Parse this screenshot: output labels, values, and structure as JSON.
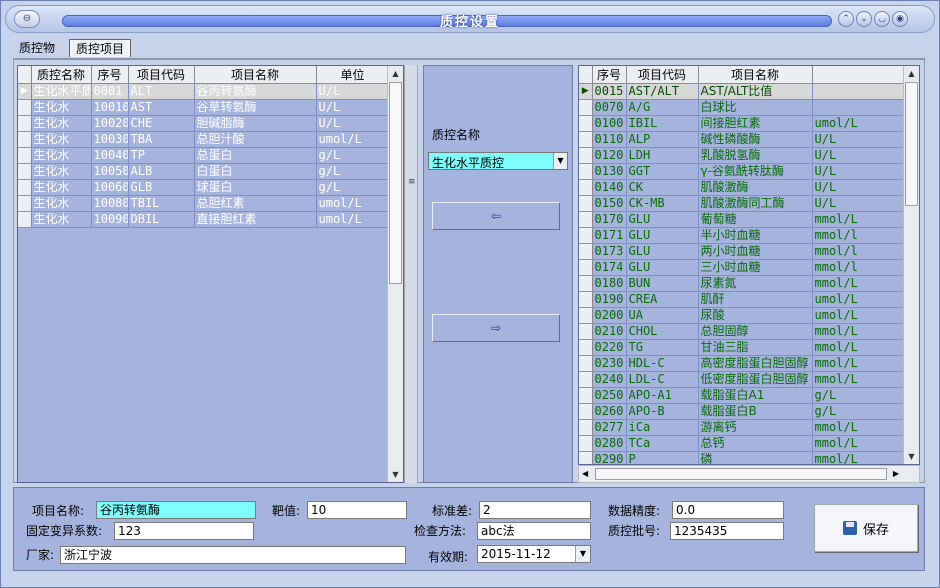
{
  "window": {
    "title": "质控设置"
  },
  "tabs": [
    "质控物",
    "质控项目"
  ],
  "left_grid": {
    "columns": [
      "质控名称",
      "序号",
      "项目代码",
      "项目名称",
      "单位"
    ],
    "rows": [
      [
        "生化水平质控",
        "0001",
        "ALT",
        "谷丙转氨酶",
        "U/L"
      ],
      [
        "生化水",
        "10010",
        "AST",
        "谷草转氨酶",
        "U/L"
      ],
      [
        "生化水",
        "10020",
        "CHE",
        "胆碱脂酶",
        "U/L"
      ],
      [
        "生化水",
        "10030",
        "TBA",
        "总胆汁酸",
        "umol/L"
      ],
      [
        "生化水",
        "10040",
        "TP",
        "总蛋白",
        "g/L"
      ],
      [
        "生化水",
        "10050",
        "ALB",
        "白蛋白",
        "g/L"
      ],
      [
        "生化水",
        "10060",
        "GLB",
        "球蛋白",
        "g/L"
      ],
      [
        "生化水",
        "10080",
        "TBIL",
        "总胆红素",
        "umol/L"
      ],
      [
        "生化水",
        "10090",
        "DBIL",
        "直接胆红素",
        "umol/L"
      ]
    ]
  },
  "middle": {
    "label": "质控名称",
    "selected": "生化水平质控",
    "btn_left": "⇦",
    "btn_right": "⇨"
  },
  "right_grid": {
    "columns": [
      "序号",
      "项目代码",
      "项目名称",
      ""
    ],
    "rows": [
      [
        "0015",
        "AST/ALT",
        "AST/ALT比值",
        ""
      ],
      [
        "0070",
        "A/G",
        "白球比",
        ""
      ],
      [
        "0100",
        "IBIL",
        "间接胆红素",
        "umol/L"
      ],
      [
        "0110",
        "ALP",
        "碱性磷酸酶",
        "U/L"
      ],
      [
        "0120",
        "LDH",
        "乳酸脱氢酶",
        "U/L"
      ],
      [
        "0130",
        "GGT",
        "γ-谷氨酰转肽酶",
        "U/L"
      ],
      [
        "0140",
        "CK",
        "肌酸激酶",
        "U/L"
      ],
      [
        "0150",
        "CK-MB",
        "肌酸激酶同工酶",
        "U/L"
      ],
      [
        "0170",
        "GLU",
        "葡萄糖",
        "mmol/L"
      ],
      [
        "0171",
        "GLU",
        "半小时血糖",
        "mmol/l"
      ],
      [
        "0173",
        "GLU",
        "两小时血糖",
        "mmol/l"
      ],
      [
        "0174",
        "GLU",
        "三小时血糖",
        "mmol/l"
      ],
      [
        "0180",
        "BUN",
        "尿素氮",
        "mmol/L"
      ],
      [
        "0190",
        "CREA",
        "肌酐",
        "umol/L"
      ],
      [
        "0200",
        "UA",
        "尿酸",
        "umol/L"
      ],
      [
        "0210",
        "CHOL",
        "总胆固醇",
        "mmol/L"
      ],
      [
        "0220",
        "TG",
        "甘油三脂",
        "mmol/L"
      ],
      [
        "0230",
        "HDL-C",
        "高密度脂蛋白胆固醇",
        "mmol/L"
      ],
      [
        "0240",
        "LDL-C",
        "低密度脂蛋白胆固醇",
        "mmol/L"
      ],
      [
        "0250",
        "APO-A1",
        "载脂蛋白A1",
        "g/L"
      ],
      [
        "0260",
        "APO-B",
        "载脂蛋白B",
        "g/L"
      ],
      [
        "0277",
        "iCa",
        "游离钙",
        "mmol/L"
      ],
      [
        "0280",
        "TCa",
        "总钙",
        "mmol/L"
      ],
      [
        "0290",
        "P",
        "磷",
        "mmol/L"
      ]
    ]
  },
  "form": {
    "item_name_label": "项目名称:",
    "item_name": "谷丙转氨酶",
    "target_label": "靶值:",
    "target": "10",
    "std_label": "标准差:",
    "std": "2",
    "precision_label": "数据精度:",
    "precision": "0.0",
    "cv_label": "固定变异系数:",
    "cv": "123",
    "method_label": "检查方法:",
    "method": "abc法",
    "lot_label": "质控批号:",
    "lot": "1235435",
    "vendor_label": "厂家:",
    "vendor": "浙江宁波",
    "expiry_label": "有效期:",
    "expiry": "2015-11-12",
    "save_label": "保存"
  }
}
